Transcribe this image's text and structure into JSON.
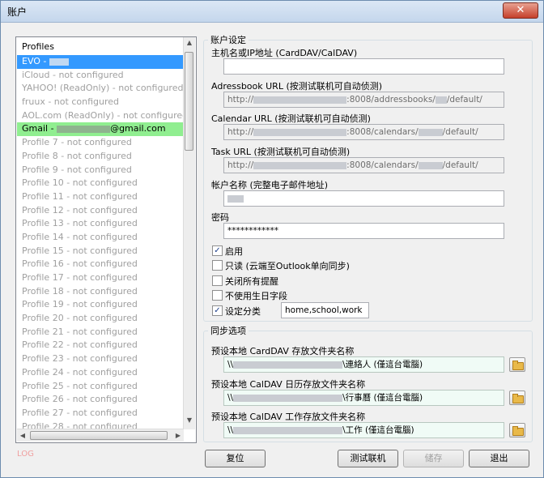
{
  "window": {
    "title": "账户"
  },
  "profiles": {
    "header": "Profiles",
    "items": [
      {
        "label": "EVO - ",
        "state": "selected"
      },
      {
        "label": "iCloud - not configured",
        "state": "normal"
      },
      {
        "label": "YAHOO! (ReadOnly) - not configured",
        "state": "normal"
      },
      {
        "label": "fruux - not configured",
        "state": "normal"
      },
      {
        "label": "AOL.com (ReadOnly) - not configured",
        "state": "normal"
      },
      {
        "label": "Gmail - ",
        "suffix": "@gmail.com",
        "state": "highlight"
      },
      {
        "label": "Profile 7 - not configured",
        "state": "normal"
      },
      {
        "label": "Profile 8 - not configured",
        "state": "normal"
      },
      {
        "label": "Profile 9 - not configured",
        "state": "normal"
      },
      {
        "label": "Profile 10 - not configured",
        "state": "normal"
      },
      {
        "label": "Profile 11 - not configured",
        "state": "normal"
      },
      {
        "label": "Profile 12 - not configured",
        "state": "normal"
      },
      {
        "label": "Profile 13 - not configured",
        "state": "normal"
      },
      {
        "label": "Profile 14 - not configured",
        "state": "normal"
      },
      {
        "label": "Profile 15 - not configured",
        "state": "normal"
      },
      {
        "label": "Profile 16 - not configured",
        "state": "normal"
      },
      {
        "label": "Profile 17 - not configured",
        "state": "normal"
      },
      {
        "label": "Profile 18 - not configured",
        "state": "normal"
      },
      {
        "label": "Profile 19 - not configured",
        "state": "normal"
      },
      {
        "label": "Profile 20 - not configured",
        "state": "normal"
      },
      {
        "label": "Profile 21 - not configured",
        "state": "normal"
      },
      {
        "label": "Profile 22 - not configured",
        "state": "normal"
      },
      {
        "label": "Profile 23 - not configured",
        "state": "normal"
      },
      {
        "label": "Profile 24 - not configured",
        "state": "normal"
      },
      {
        "label": "Profile 25 - not configured",
        "state": "normal"
      },
      {
        "label": "Profile 26 - not configured",
        "state": "normal"
      },
      {
        "label": "Profile 27 - not configured",
        "state": "normal"
      },
      {
        "label": "Profile 28 - not configured",
        "state": "normal"
      }
    ]
  },
  "log_label": "LOG",
  "account": {
    "group_title": "账户设定",
    "host_label": "主机名或IP地址 (CardDAV/CalDAV)",
    "host_value": "",
    "addressbook_label": "Adressbook URL (按测试联机可自动侦测)",
    "addressbook_prefix": "http://",
    "addressbook_suffix": ":8008/addressbooks/",
    "addressbook_end": "/default/",
    "calendar_label": "Calendar URL (按测试联机可自动侦测)",
    "calendar_prefix": "http://",
    "calendar_suffix": ":8008/calendars/",
    "calendar_end": "/default/",
    "task_label": "Task URL (按测试联机可自动侦测)",
    "task_prefix": "http://",
    "task_suffix": ":8008/calendars/",
    "task_end": "/default/",
    "username_label": "帐户名称 (完整电子邮件地址)",
    "password_label": "密码",
    "password_value": "************",
    "checkboxes": [
      {
        "label": "启用",
        "checked": true
      },
      {
        "label": "只读 (云端至Outlook单向同步)",
        "checked": false
      },
      {
        "label": "关闭所有提醒",
        "checked": false
      },
      {
        "label": "不使用生日字段",
        "checked": false
      },
      {
        "label": "设定分类",
        "checked": true
      }
    ],
    "categories_value": "home,school,work"
  },
  "sync": {
    "group_title": "同步选项",
    "carddav_label": "预设本地 CardDAV 存放文件夹名称",
    "carddav_prefix": "\\\\",
    "carddav_suffix": "\\連絡人 (僅這台電腦)",
    "caldav_label": "预设本地 CalDAV 日历存放文件夹名称",
    "caldav_prefix": "\\\\",
    "caldav_suffix": "\\行事曆 (僅這台電腦)",
    "task_label": "预设本地 CalDAV 工作存放文件夹名称",
    "task_prefix": "\\\\",
    "task_suffix": "\\工作 (僅這台電腦)"
  },
  "buttons": {
    "reset": "复位",
    "test": "测试联机",
    "save": "储存",
    "exit": "退出"
  }
}
